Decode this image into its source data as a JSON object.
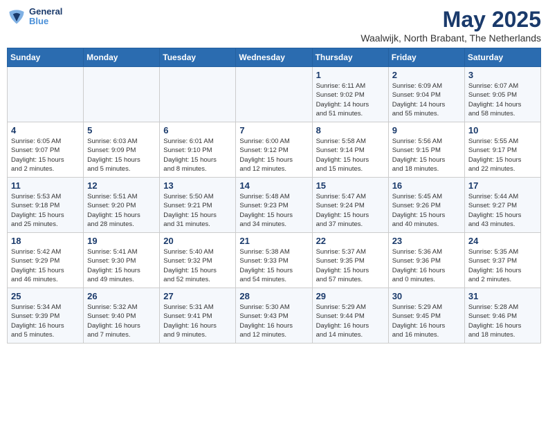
{
  "header": {
    "logo_line1": "General",
    "logo_line2": "Blue",
    "title": "May 2025",
    "subtitle": "Waalwijk, North Brabant, The Netherlands"
  },
  "days_of_week": [
    "Sunday",
    "Monday",
    "Tuesday",
    "Wednesday",
    "Thursday",
    "Friday",
    "Saturday"
  ],
  "weeks": [
    [
      {
        "day": "",
        "info": ""
      },
      {
        "day": "",
        "info": ""
      },
      {
        "day": "",
        "info": ""
      },
      {
        "day": "",
        "info": ""
      },
      {
        "day": "1",
        "info": "Sunrise: 6:11 AM\nSunset: 9:02 PM\nDaylight: 14 hours\nand 51 minutes."
      },
      {
        "day": "2",
        "info": "Sunrise: 6:09 AM\nSunset: 9:04 PM\nDaylight: 14 hours\nand 55 minutes."
      },
      {
        "day": "3",
        "info": "Sunrise: 6:07 AM\nSunset: 9:05 PM\nDaylight: 14 hours\nand 58 minutes."
      }
    ],
    [
      {
        "day": "4",
        "info": "Sunrise: 6:05 AM\nSunset: 9:07 PM\nDaylight: 15 hours\nand 2 minutes."
      },
      {
        "day": "5",
        "info": "Sunrise: 6:03 AM\nSunset: 9:09 PM\nDaylight: 15 hours\nand 5 minutes."
      },
      {
        "day": "6",
        "info": "Sunrise: 6:01 AM\nSunset: 9:10 PM\nDaylight: 15 hours\nand 8 minutes."
      },
      {
        "day": "7",
        "info": "Sunrise: 6:00 AM\nSunset: 9:12 PM\nDaylight: 15 hours\nand 12 minutes."
      },
      {
        "day": "8",
        "info": "Sunrise: 5:58 AM\nSunset: 9:14 PM\nDaylight: 15 hours\nand 15 minutes."
      },
      {
        "day": "9",
        "info": "Sunrise: 5:56 AM\nSunset: 9:15 PM\nDaylight: 15 hours\nand 18 minutes."
      },
      {
        "day": "10",
        "info": "Sunrise: 5:55 AM\nSunset: 9:17 PM\nDaylight: 15 hours\nand 22 minutes."
      }
    ],
    [
      {
        "day": "11",
        "info": "Sunrise: 5:53 AM\nSunset: 9:18 PM\nDaylight: 15 hours\nand 25 minutes."
      },
      {
        "day": "12",
        "info": "Sunrise: 5:51 AM\nSunset: 9:20 PM\nDaylight: 15 hours\nand 28 minutes."
      },
      {
        "day": "13",
        "info": "Sunrise: 5:50 AM\nSunset: 9:21 PM\nDaylight: 15 hours\nand 31 minutes."
      },
      {
        "day": "14",
        "info": "Sunrise: 5:48 AM\nSunset: 9:23 PM\nDaylight: 15 hours\nand 34 minutes."
      },
      {
        "day": "15",
        "info": "Sunrise: 5:47 AM\nSunset: 9:24 PM\nDaylight: 15 hours\nand 37 minutes."
      },
      {
        "day": "16",
        "info": "Sunrise: 5:45 AM\nSunset: 9:26 PM\nDaylight: 15 hours\nand 40 minutes."
      },
      {
        "day": "17",
        "info": "Sunrise: 5:44 AM\nSunset: 9:27 PM\nDaylight: 15 hours\nand 43 minutes."
      }
    ],
    [
      {
        "day": "18",
        "info": "Sunrise: 5:42 AM\nSunset: 9:29 PM\nDaylight: 15 hours\nand 46 minutes."
      },
      {
        "day": "19",
        "info": "Sunrise: 5:41 AM\nSunset: 9:30 PM\nDaylight: 15 hours\nand 49 minutes."
      },
      {
        "day": "20",
        "info": "Sunrise: 5:40 AM\nSunset: 9:32 PM\nDaylight: 15 hours\nand 52 minutes."
      },
      {
        "day": "21",
        "info": "Sunrise: 5:38 AM\nSunset: 9:33 PM\nDaylight: 15 hours\nand 54 minutes."
      },
      {
        "day": "22",
        "info": "Sunrise: 5:37 AM\nSunset: 9:35 PM\nDaylight: 15 hours\nand 57 minutes."
      },
      {
        "day": "23",
        "info": "Sunrise: 5:36 AM\nSunset: 9:36 PM\nDaylight: 16 hours\nand 0 minutes."
      },
      {
        "day": "24",
        "info": "Sunrise: 5:35 AM\nSunset: 9:37 PM\nDaylight: 16 hours\nand 2 minutes."
      }
    ],
    [
      {
        "day": "25",
        "info": "Sunrise: 5:34 AM\nSunset: 9:39 PM\nDaylight: 16 hours\nand 5 minutes."
      },
      {
        "day": "26",
        "info": "Sunrise: 5:32 AM\nSunset: 9:40 PM\nDaylight: 16 hours\nand 7 minutes."
      },
      {
        "day": "27",
        "info": "Sunrise: 5:31 AM\nSunset: 9:41 PM\nDaylight: 16 hours\nand 9 minutes."
      },
      {
        "day": "28",
        "info": "Sunrise: 5:30 AM\nSunset: 9:43 PM\nDaylight: 16 hours\nand 12 minutes."
      },
      {
        "day": "29",
        "info": "Sunrise: 5:29 AM\nSunset: 9:44 PM\nDaylight: 16 hours\nand 14 minutes."
      },
      {
        "day": "30",
        "info": "Sunrise: 5:29 AM\nSunset: 9:45 PM\nDaylight: 16 hours\nand 16 minutes."
      },
      {
        "day": "31",
        "info": "Sunrise: 5:28 AM\nSunset: 9:46 PM\nDaylight: 16 hours\nand 18 minutes."
      }
    ]
  ]
}
